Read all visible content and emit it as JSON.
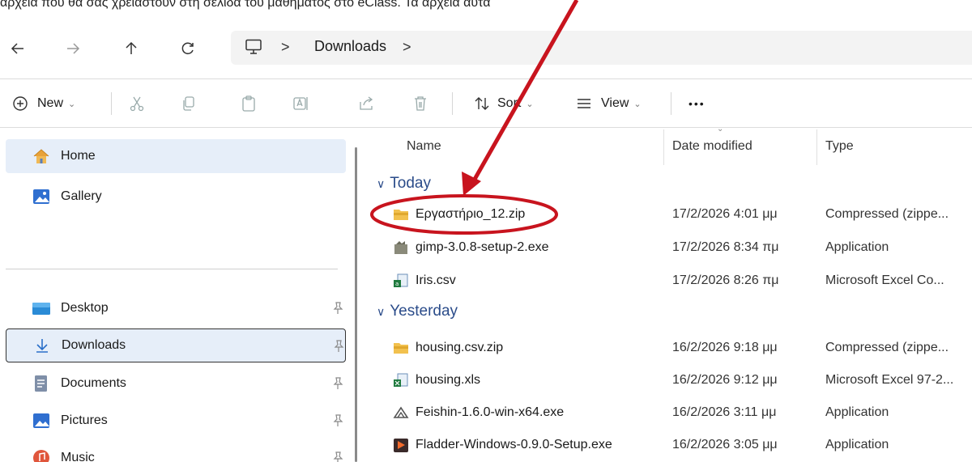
{
  "caption": "αρχεία που θα σας χρειαστούν στη σελίδα του μαθήματος στο eClass. Τα αρχεία αυτά",
  "colors": {
    "accent": "#2b4c8a",
    "selection": "#e6eef9",
    "annotation": "#c8141e"
  },
  "address": {
    "separator": ">",
    "path": [
      "Downloads"
    ],
    "trailing_separator": ">"
  },
  "toolbar": {
    "new_label": "New",
    "sort_label": "Sort",
    "view_label": "View",
    "more_label": "•••",
    "caret": "⌄"
  },
  "sidebar": {
    "items": [
      {
        "label": "Home",
        "icon": "home-icon"
      },
      {
        "label": "Gallery",
        "icon": "gallery-icon"
      },
      {
        "label": "Desktop",
        "icon": "desktop-icon",
        "pinned": true
      },
      {
        "label": "Downloads",
        "icon": "download-icon",
        "pinned": true
      },
      {
        "label": "Documents",
        "icon": "documents-icon",
        "pinned": true
      },
      {
        "label": "Pictures",
        "icon": "pictures-icon",
        "pinned": true
      },
      {
        "label": "Music",
        "icon": "music-icon",
        "pinned": true
      }
    ]
  },
  "list": {
    "columns": {
      "name": "Name",
      "date": "Date modified",
      "type": "Type"
    },
    "groups": [
      {
        "label": "Today",
        "rows": [
          {
            "name": "Εργαστήριο_12.zip",
            "date": "17/2/2026 4:01 μμ",
            "type": "Compressed (zippe...",
            "icon": "zip-folder-icon"
          },
          {
            "name": "gimp-3.0.8-setup-2.exe",
            "date": "17/2/2026 8:34 πμ",
            "type": "Application",
            "icon": "installer-icon"
          },
          {
            "name": "Iris.csv",
            "date": "17/2/2026 8:26 πμ",
            "type": "Microsoft Excel Co...",
            "icon": "csv-icon"
          }
        ]
      },
      {
        "label": "Yesterday",
        "rows": [
          {
            "name": "housing.csv.zip",
            "date": "16/2/2026 9:18 μμ",
            "type": "Compressed (zippe...",
            "icon": "zip-folder-icon"
          },
          {
            "name": "housing.xls",
            "date": "16/2/2026 9:12 μμ",
            "type": "Microsoft Excel 97-2...",
            "icon": "excel-icon"
          },
          {
            "name": "Feishin-1.6.0-win-x64.exe",
            "date": "16/2/2026 3:11 μμ",
            "type": "Application",
            "icon": "feishin-icon"
          },
          {
            "name": "Fladder-Windows-0.9.0-Setup.exe",
            "date": "16/2/2026 3:05 μμ",
            "type": "Application",
            "icon": "fladder-icon"
          }
        ]
      }
    ]
  }
}
